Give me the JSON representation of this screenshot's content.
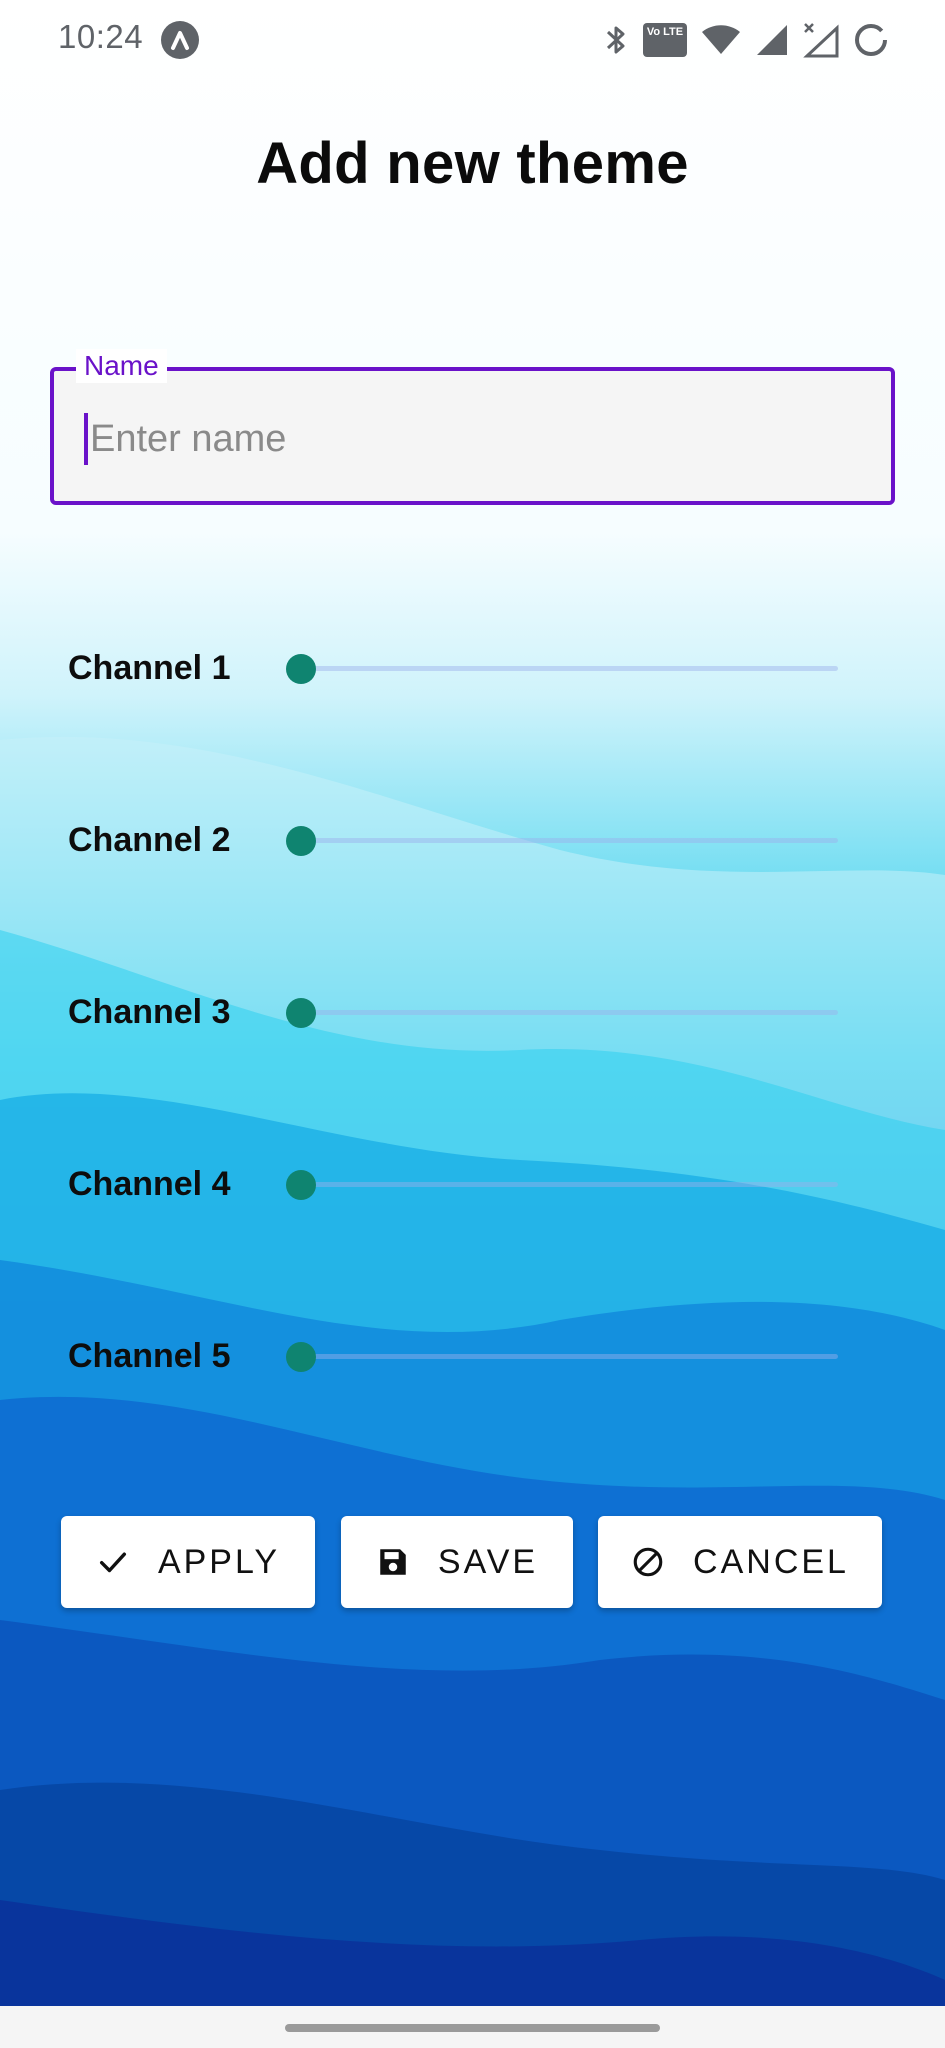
{
  "status_bar": {
    "time": "10:24",
    "lte_badge": "Vo LTE",
    "icons": [
      "app-notification-icon",
      "bluetooth-icon",
      "volte-icon",
      "wifi-icon",
      "signal-icon",
      "signal-no-service-icon",
      "battery-saver-icon"
    ]
  },
  "page": {
    "title": "Add new theme"
  },
  "name_field": {
    "label": "Name",
    "placeholder": "Enter name",
    "value": ""
  },
  "channels": [
    {
      "label": "Channel 1",
      "value": 0
    },
    {
      "label": "Channel 2",
      "value": 0
    },
    {
      "label": "Channel 3",
      "value": 0
    },
    {
      "label": "Channel 4",
      "value": 0
    },
    {
      "label": "Channel 5",
      "value": 0
    }
  ],
  "actions": {
    "apply": {
      "label": "APPLY",
      "icon": "check-icon"
    },
    "save": {
      "label": "SAVE",
      "icon": "floppy-disk-icon"
    },
    "cancel": {
      "label": "CANCEL",
      "icon": "block-icon"
    }
  },
  "colors": {
    "accent": "#6a12c9",
    "slider_thumb": "#0f8470",
    "background_top": "#ffffff",
    "background_bottom": "#0a2a9c"
  }
}
